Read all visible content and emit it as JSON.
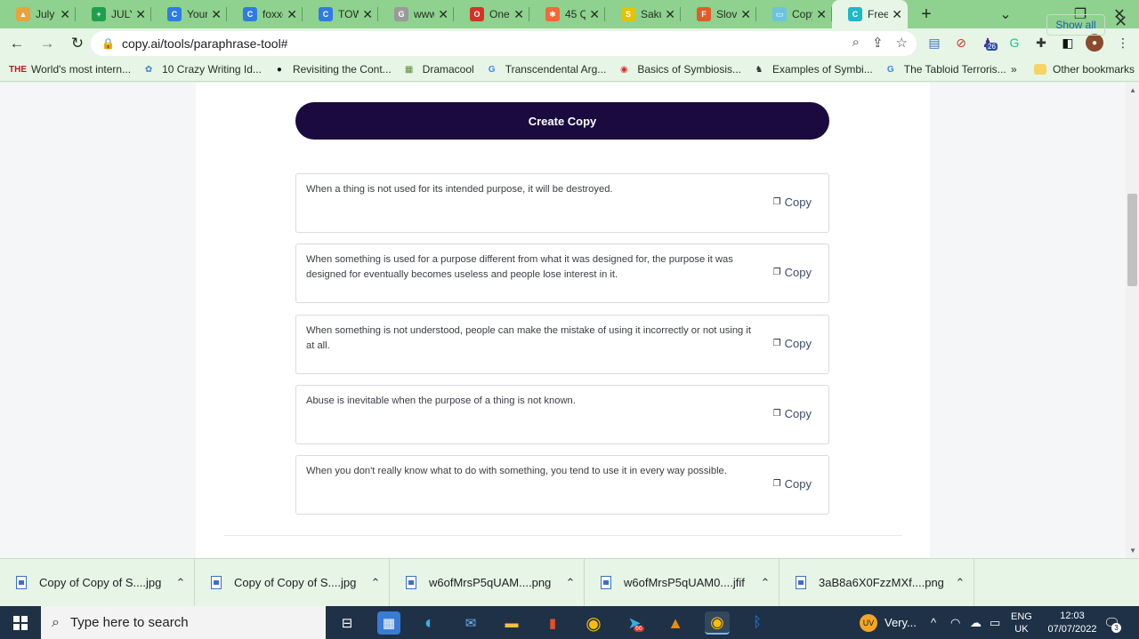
{
  "browser": {
    "tabs": [
      {
        "label": "July",
        "color": "#e8a33d",
        "glyph": "▲"
      },
      {
        "label": "JULY",
        "color": "#1e9e4f",
        "glyph": "+"
      },
      {
        "label": "Your",
        "color": "#2f7be5",
        "glyph": "C"
      },
      {
        "label": "foxxe",
        "color": "#2f7be5",
        "glyph": "C"
      },
      {
        "label": "TOW",
        "color": "#2f7be5",
        "glyph": "C"
      },
      {
        "label": "www",
        "color": "#9a9a9a",
        "glyph": "G"
      },
      {
        "label": "One",
        "color": "#d93025",
        "glyph": "O"
      },
      {
        "label": "45 Q",
        "color": "#f4673a",
        "glyph": "✱"
      },
      {
        "label": "Saku",
        "color": "#e6c200",
        "glyph": "S"
      },
      {
        "label": "Slova",
        "color": "#e25b2a",
        "glyph": "F"
      },
      {
        "label": "Copy",
        "color": "#6cc3e0",
        "glyph": "▭"
      },
      {
        "label": "Free",
        "color": "#20b7c8",
        "glyph": "C",
        "active": true
      }
    ],
    "url": "copy.ai/tools/paraphrase-tool#",
    "bookmarks": [
      {
        "label": "World's most intern...",
        "icon": "THE",
        "color": "#c4161c"
      },
      {
        "label": "10 Crazy Writing Id...",
        "icon": "✿",
        "color": "#3b7dd8"
      },
      {
        "label": "Revisiting the Cont...",
        "icon": "●",
        "color": "#111111"
      },
      {
        "label": "Dramacool",
        "icon": "▦",
        "color": "#5b8c3a"
      },
      {
        "label": "Transcendental Arg...",
        "icon": "G",
        "color": "#4285f4"
      },
      {
        "label": "Basics of Symbiosis...",
        "icon": "◉",
        "color": "#d93025"
      },
      {
        "label": "Examples of Symbi...",
        "icon": "♞",
        "color": "#333333"
      },
      {
        "label": "The Tabloid Terroris...",
        "icon": "G",
        "color": "#4285f4"
      }
    ],
    "bookmarks_more": "»",
    "other_bookmarks": "Other bookmarks",
    "extension_badge": "26"
  },
  "page": {
    "create_button": "Create Copy",
    "copy_label": "Copy",
    "results": [
      "When a thing is not used for its intended purpose, it will be destroyed.",
      "When something is used for a purpose different from what it was designed for, the purpose it was designed for eventually becomes useless and people lose interest in it.",
      "When something is not understood, people can make the mistake of using it incorrectly or not using it at all.",
      "Abuse is inevitable when the purpose of a thing is not known.",
      "When you don't really know what to do with something, you tend to use it in every way possible."
    ]
  },
  "downloads": {
    "items": [
      "Copy of Copy of S....jpg",
      "Copy of Copy of S....jpg",
      "w6ofMrsP5qUAM....png",
      "w6ofMrsP5qUAM0....jfif",
      "3aB8a6X0FzzMXf....png"
    ],
    "show_all": "Show all"
  },
  "taskbar": {
    "search_placeholder": "Type here to search",
    "weather": "Very...",
    "lang_top": "ENG",
    "lang_bottom": "UK",
    "time": "12:03",
    "date": "07/07/2022",
    "notifications": "3",
    "office_badge": "66"
  }
}
